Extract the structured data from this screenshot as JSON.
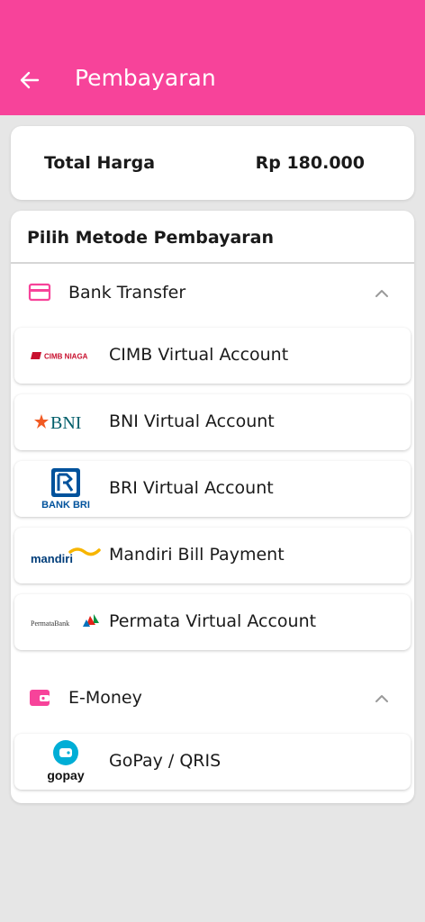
{
  "header": {
    "title": "Pembayaran",
    "back_icon": "arrow-left-icon",
    "color": "#f7439a"
  },
  "total": {
    "label": "Total Harga",
    "value": "Rp 180.000"
  },
  "methods": {
    "title": "Pilih Metode Pembayaran",
    "sections": [
      {
        "label": "Bank Transfer",
        "icon": "credit-card-icon",
        "expanded": true,
        "items": [
          {
            "label": "CIMB Virtual Account",
            "logo": "cimb-niaga-logo",
            "logo_text": "CIMB NIAGA"
          },
          {
            "label": "BNI Virtual Account",
            "logo": "bni-logo",
            "logo_text": "BNI"
          },
          {
            "label": "BRI Virtual Account",
            "logo": "bank-bri-logo",
            "logo_text": "BANK BRI"
          },
          {
            "label": "Mandiri Bill Payment",
            "logo": "mandiri-logo",
            "logo_text": "mandiri"
          },
          {
            "label": "Permata Virtual Account",
            "logo": "permata-bank-logo",
            "logo_text": "PermataBank"
          }
        ]
      },
      {
        "label": "E-Money",
        "icon": "wallet-icon",
        "expanded": true,
        "items": [
          {
            "label": "GoPay / QRIS",
            "logo": "gopay-logo",
            "logo_text": "gopay"
          }
        ]
      }
    ]
  }
}
